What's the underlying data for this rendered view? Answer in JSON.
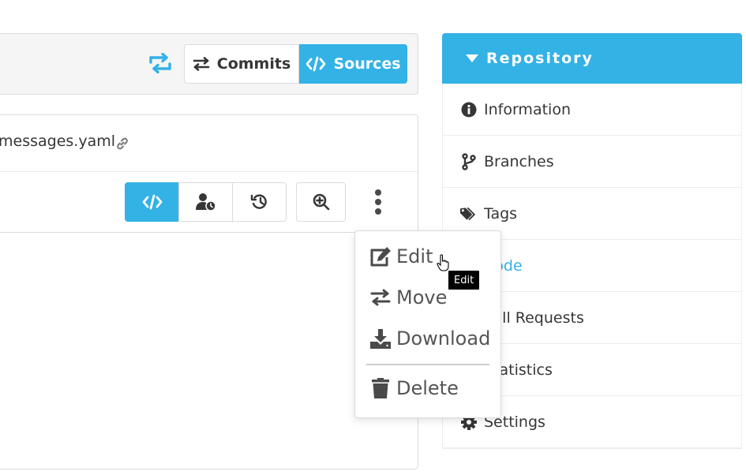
{
  "toolbar": {
    "commits_label": "Commits",
    "sources_label": "Sources"
  },
  "file": {
    "name": "messages.yaml"
  },
  "sidebar": {
    "title": "Repository",
    "items": [
      {
        "label": "Information",
        "icon": "info-circle-icon"
      },
      {
        "label": "Branches",
        "icon": "branch-icon"
      },
      {
        "label": "Tags",
        "icon": "tags-icon"
      },
      {
        "label": "Code",
        "icon": "code-icon",
        "active": true
      },
      {
        "label": "Pull Requests",
        "icon": "pull-request-icon"
      },
      {
        "label": "Statistics",
        "icon": "chart-icon"
      },
      {
        "label": "Settings",
        "icon": "gear-icon"
      }
    ]
  },
  "menu": {
    "items": [
      {
        "label": "Edit",
        "icon": "edit-icon"
      },
      {
        "label": "Move",
        "icon": "exchange-icon"
      },
      {
        "label": "Download",
        "icon": "download-icon"
      },
      {
        "label": "Delete",
        "icon": "trash-icon"
      }
    ]
  },
  "tooltip": {
    "text": "Edit"
  },
  "colors": {
    "accent": "#33b2e6",
    "text": "#363636",
    "border": "#dbdbdb"
  }
}
